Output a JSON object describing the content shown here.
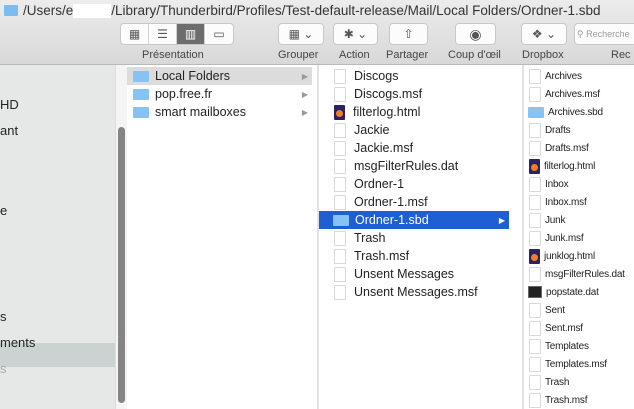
{
  "path": {
    "before": "/Users/e",
    "after": "/Library/Thunderbird/Profiles/Test-default-release/Mail/Local Folders/Ordner-1.sbd"
  },
  "toolbar": {
    "presentation": "Présentation",
    "grouper": "Grouper",
    "action": "Action",
    "partager": "Partager",
    "coup": "Coup d'œil",
    "dropbox": "Dropbox",
    "search_placeholder": "Recherche",
    "search_label": "Rec"
  },
  "sidebar": {
    "items": [
      "HD",
      "ant",
      "e",
      "",
      "s",
      "ments",
      "s"
    ]
  },
  "columns": [
    [
      {
        "n": "Local Folders",
        "t": "folder",
        "state": "sel"
      },
      {
        "n": "pop.free.fr",
        "t": "folder"
      },
      {
        "n": "smart mailboxes",
        "t": "folder"
      }
    ],
    [
      {
        "n": "Discogs",
        "t": "file"
      },
      {
        "n": "Discogs.msf",
        "t": "file"
      },
      {
        "n": "filterlog.html",
        "t": "html"
      },
      {
        "n": "Jackie",
        "t": "file"
      },
      {
        "n": "Jackie.msf",
        "t": "file"
      },
      {
        "n": "msgFilterRules.dat",
        "t": "file"
      },
      {
        "n": "Ordner-1",
        "t": "file"
      },
      {
        "n": "Ordner-1.msf",
        "t": "file"
      },
      {
        "n": "Ordner-1.sbd",
        "t": "folder",
        "state": "act"
      },
      {
        "n": "Trash",
        "t": "file"
      },
      {
        "n": "Trash.msf",
        "t": "file"
      },
      {
        "n": "Unsent Messages",
        "t": "file"
      },
      {
        "n": "Unsent Messages.msf",
        "t": "file"
      }
    ],
    [
      {
        "n": "Archives",
        "t": "file"
      },
      {
        "n": "Archives.msf",
        "t": "file"
      },
      {
        "n": "Archives.sbd",
        "t": "folder"
      },
      {
        "n": "Drafts",
        "t": "file"
      },
      {
        "n": "Drafts.msf",
        "t": "file"
      },
      {
        "n": "filterlog.html",
        "t": "html"
      },
      {
        "n": "Inbox",
        "t": "file"
      },
      {
        "n": "Inbox.msf",
        "t": "file"
      },
      {
        "n": "Junk",
        "t": "file"
      },
      {
        "n": "Junk.msf",
        "t": "file"
      },
      {
        "n": "junklog.html",
        "t": "html"
      },
      {
        "n": "msgFilterRules.dat",
        "t": "file"
      },
      {
        "n": "popstate.dat",
        "t": "term"
      },
      {
        "n": "Sent",
        "t": "file"
      },
      {
        "n": "Sent.msf",
        "t": "file"
      },
      {
        "n": "Templates",
        "t": "file"
      },
      {
        "n": "Templates.msf",
        "t": "file"
      },
      {
        "n": "Trash",
        "t": "file"
      },
      {
        "n": "Trash.msf",
        "t": "file"
      }
    ]
  ]
}
